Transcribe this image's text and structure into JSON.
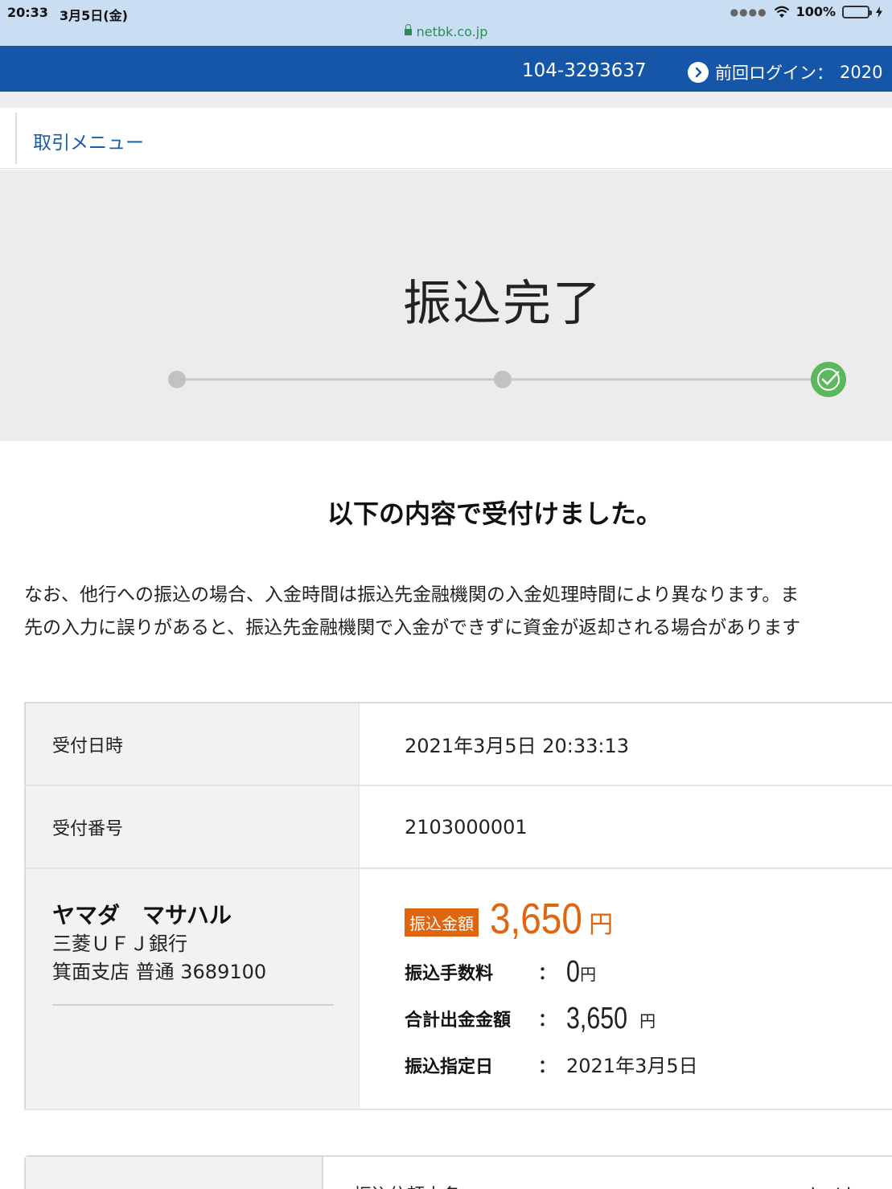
{
  "status_bar": {
    "time": "20:33",
    "date": "3月5日(金)",
    "battery": "100%",
    "url": "netbk.co.jp"
  },
  "header": {
    "account_number": "104-3293637",
    "last_login_label": "前回ログイン：",
    "last_login_value": "2020"
  },
  "menu": {
    "link": "取引メニュー"
  },
  "hero": {
    "title": "振込完了",
    "steps_total": 3,
    "current_step": 3
  },
  "main": {
    "confirm": "以下の内容で受付けました。",
    "note_line1": "なお、他行への振込の場合、入金時間は振込先金融機関の入金処理時間により異なります。ま",
    "note_line2": "先の入力に誤りがあると、振込先金融機関で入金ができずに資金が返却される場合があります"
  },
  "table": {
    "received_label": "受付日時",
    "received_value": "2021年3月5日 20:33:13",
    "number_label": "受付番号",
    "number_value": "2103000001",
    "payee": {
      "name": "ヤマダ　マサハル",
      "bank": "三菱ＵＦＪ銀行",
      "branch": "箕面支店 普通 3689100"
    },
    "amount_badge": "振込金額",
    "amount_value": "3,650",
    "amount_unit": "円",
    "fee_label": "振込手数料",
    "fee_value": "0",
    "fee_unit": "円",
    "total_label": "合計出金金額",
    "total_value": "3,650",
    "total_unit": "円",
    "date_label": "振込指定日",
    "date_value": "2021年3月5日",
    "colon": "："
  },
  "next_table": {
    "label": "振込依頼人名",
    "value": "ヤメセ"
  },
  "colors": {
    "header_blue": "#1556a8",
    "accent_orange": "#e0650f",
    "step_green": "#5cb85c",
    "link_blue": "#1a5ea8"
  }
}
